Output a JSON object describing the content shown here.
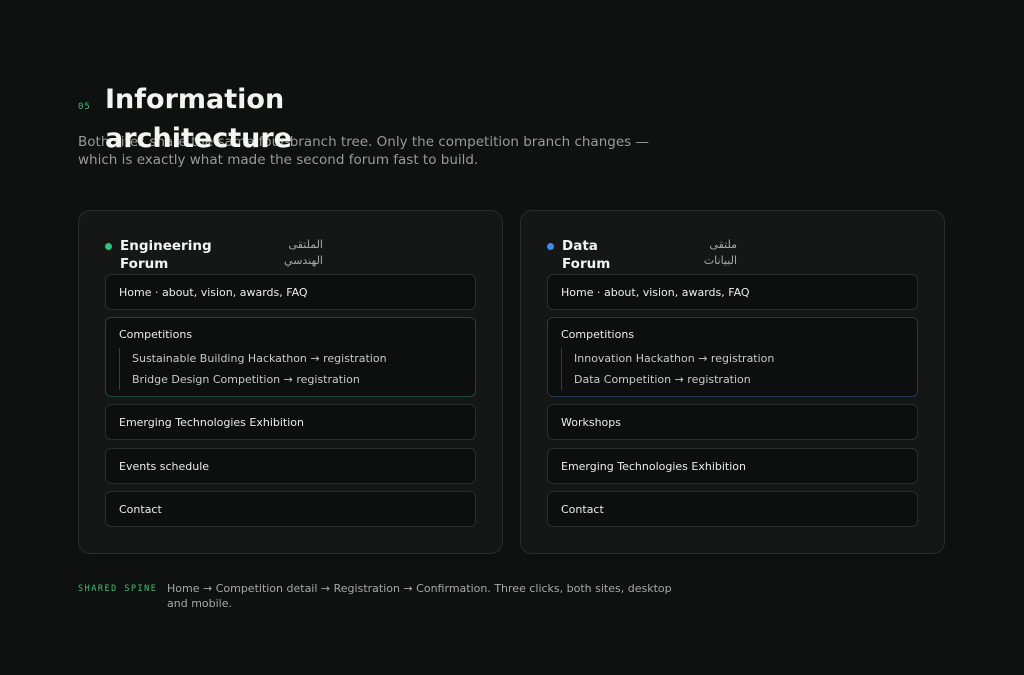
{
  "header": {
    "section_number": "05",
    "title": "Information architecture",
    "lede": "Both sites share the same four-branch tree. Only the competition branch changes — which is exactly what made the second forum fast to build."
  },
  "sites": [
    {
      "name": "Engineering Forum",
      "arabic_name": "الملتقى الهندسي",
      "dot_color": "#2ec27e",
      "home": "Home · about, vision, awards, FAQ",
      "competitions": {
        "label": "Competitions",
        "children": [
          "Sustainable Building Hackathon → registration",
          "Bridge Design Competition → registration"
        ]
      },
      "items": [
        "Emerging Technologies Exhibition",
        "Events schedule",
        "Contact"
      ]
    },
    {
      "name": "Data Forum",
      "arabic_name": "ملتقى البيانات",
      "dot_color": "#3b8cf0",
      "home": "Home · about, vision, awards, FAQ",
      "competitions": {
        "label": "Competitions",
        "children": [
          "Innovation Hackathon → registration",
          "Data Competition → registration"
        ]
      },
      "items": [
        "Workshops",
        "Emerging Technologies Exhibition",
        "Contact"
      ]
    }
  ],
  "spine": {
    "tag": "SHARED SPINE",
    "text": "Home → Competition detail → Registration → Confirmation. Three clicks, both sites, desktop and mobile."
  }
}
